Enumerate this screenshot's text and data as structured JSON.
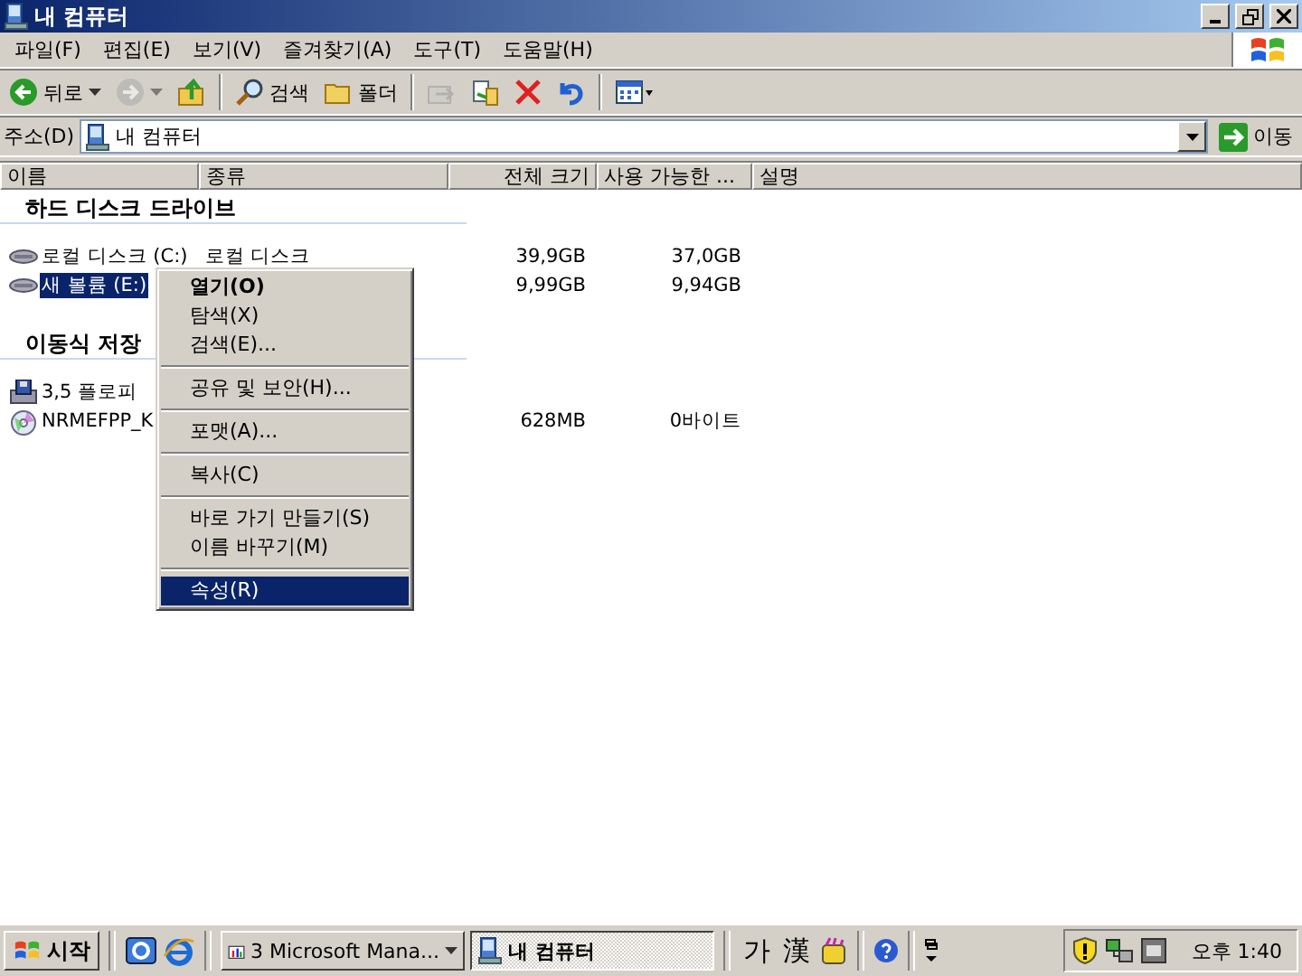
{
  "window": {
    "title": "내 컴퓨터"
  },
  "menu_bar": [
    "파일(F)",
    "편집(E)",
    "보기(V)",
    "즐겨찾기(A)",
    "도구(T)",
    "도움말(H)"
  ],
  "toolbar": [
    {
      "kind": "back",
      "label": "뒤로",
      "disabled": false
    },
    {
      "kind": "forward",
      "disabled": true
    },
    {
      "kind": "up",
      "disabled": false
    },
    {
      "kind": "search",
      "label": "검색",
      "disabled": false
    },
    {
      "kind": "folders",
      "label": "폴더",
      "disabled": false
    },
    {
      "kind": "move",
      "disabled": true
    },
    {
      "kind": "copy",
      "disabled": false
    },
    {
      "kind": "delete",
      "disabled": false
    },
    {
      "kind": "undo",
      "disabled": false
    },
    {
      "kind": "views",
      "disabled": false
    }
  ],
  "address": {
    "label": "주소(D)",
    "value": "내 컴퓨터",
    "go": "이동"
  },
  "table": {
    "columns": [
      "이름",
      "종류",
      "전체 크기",
      "사용 가능한 ...",
      "설명"
    ],
    "groups": [
      {
        "title": "하드 디스크 드라이브",
        "rows": [
          {
            "kind": "disk",
            "name": "로컬 디스크 (C:)",
            "type": "로컬 디스크",
            "total": "39,9GB",
            "free": "37,0GB",
            "selected": false
          },
          {
            "kind": "disk",
            "name": "새 볼륨 (E:)",
            "total": "9,99GB",
            "free": "9,94GB",
            "selected": true
          }
        ]
      },
      {
        "title": "이동식 저장",
        "rows": [
          {
            "kind": "floppy",
            "name": "3,5 플로피",
            "selected": false
          },
          {
            "kind": "cd",
            "name": "NRMEFPP_K",
            "total": "628MB",
            "free": "0바이트",
            "selected": false
          }
        ]
      }
    ]
  },
  "context_menu": [
    [
      {
        "label": "열기(O)",
        "default": true,
        "selected": false
      },
      {
        "label": "탐색(X)",
        "default": false,
        "selected": false
      },
      {
        "label": "검색(E)...",
        "default": false,
        "selected": false
      }
    ],
    [
      {
        "label": "공유 및 보안(H)...",
        "default": false,
        "selected": false
      }
    ],
    [
      {
        "label": "포맷(A)...",
        "default": false,
        "selected": false
      }
    ],
    [
      {
        "label": "복사(C)",
        "default": false,
        "selected": false
      }
    ],
    [
      {
        "label": "바로 가기 만들기(S)",
        "default": false,
        "selected": false
      },
      {
        "label": "이름 바꾸기(M)",
        "default": false,
        "selected": false
      }
    ],
    [
      {
        "label": "속성(R)",
        "default": false,
        "selected": true
      }
    ]
  ],
  "taskbar": {
    "start": "시작",
    "tasks": [
      {
        "kind": "mmc",
        "label": "3 Microsoft Mana...",
        "selected": false
      },
      {
        "kind": "computer",
        "label": "내 컴퓨터",
        "selected": true
      }
    ],
    "language": [
      "가",
      "漢"
    ],
    "clock": "오후 1:40"
  }
}
